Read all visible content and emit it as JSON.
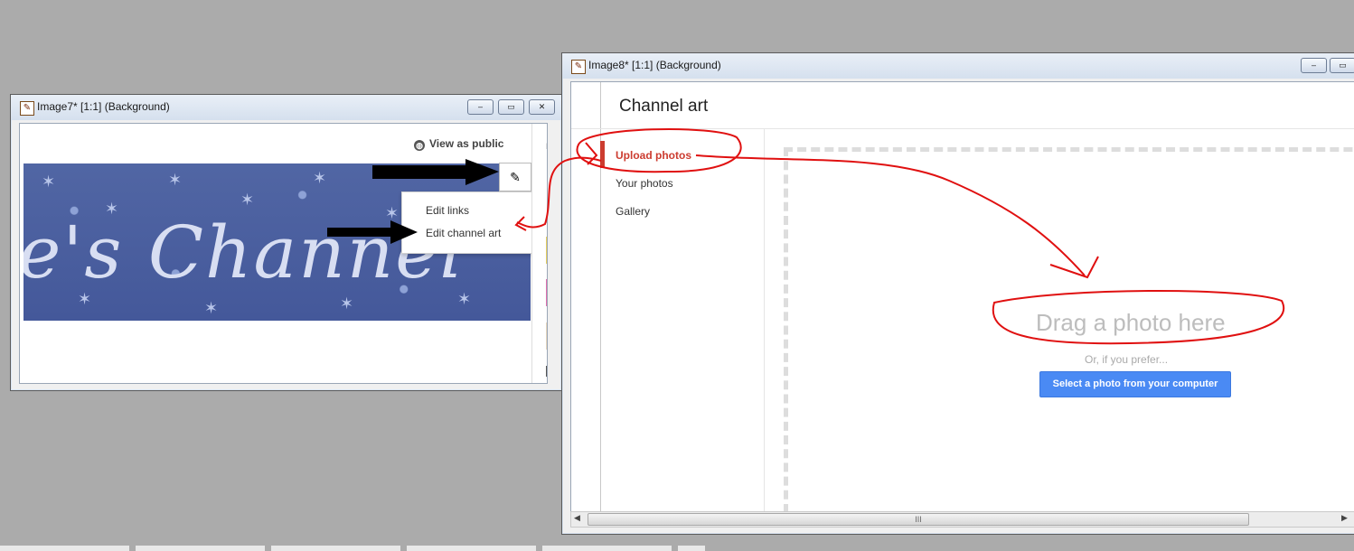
{
  "window1": {
    "title": "Image7* [1:1] (Background)",
    "controls": {
      "minimize": "‒",
      "restore": "▭",
      "close": "✕"
    },
    "view_public": "View as public",
    "banner_text": "e's Channel",
    "menu": {
      "edit_links": "Edit links",
      "edit_channel_art": "Edit channel art"
    },
    "side_letter": "F"
  },
  "window2": {
    "title": "Image8* [1:1] (Background)",
    "controls": {
      "minimize": "‒",
      "restore": "▭"
    },
    "page_title": "Channel art",
    "nav": [
      {
        "label": "Upload photos",
        "active": true
      },
      {
        "label": "Your photos",
        "active": false
      },
      {
        "label": "Gallery",
        "active": false
      }
    ],
    "drag_text": "Drag a photo here",
    "prefer_text": "Or, if you prefer...",
    "select_button": "Select a photo from your computer",
    "scroll_grip": "III"
  },
  "colors": {
    "annotation_red": "#e01010",
    "accent_red": "#cc3c30",
    "button_blue": "#4a8af4"
  }
}
